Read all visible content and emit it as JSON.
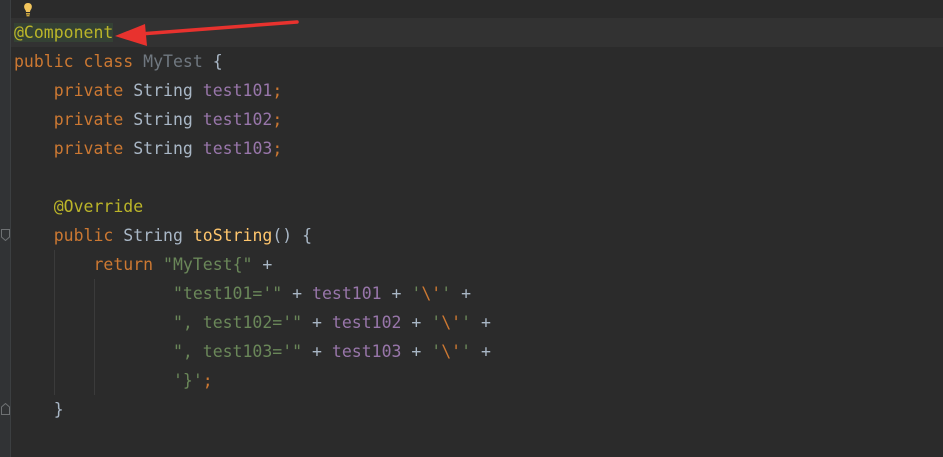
{
  "editor": {
    "language": "Java",
    "colors": {
      "background": "#2b2b2b",
      "keyword": "#cc7832",
      "annotation": "#bbb529",
      "field": "#9876aa",
      "string": "#6a8759",
      "method": "#ffc66d",
      "default": "#a9b7c6",
      "arrow": "#e8322e"
    },
    "lines": [
      [
        {
          "t": "@Component",
          "c": "ann-hl"
        }
      ],
      [
        {
          "t": "public",
          "c": "kw"
        },
        {
          "t": " ",
          "c": "plain"
        },
        {
          "t": "class",
          "c": "kw"
        },
        {
          "t": " ",
          "c": "plain"
        },
        {
          "t": "MyTest",
          "c": "cls-unused"
        },
        {
          "t": " {",
          "c": "plain"
        }
      ],
      [
        {
          "t": "    ",
          "c": "plain"
        },
        {
          "t": "private",
          "c": "kw"
        },
        {
          "t": " String ",
          "c": "plain"
        },
        {
          "t": "test101",
          "c": "field"
        },
        {
          "t": ";",
          "c": "kw"
        }
      ],
      [
        {
          "t": "    ",
          "c": "plain"
        },
        {
          "t": "private",
          "c": "kw"
        },
        {
          "t": " String ",
          "c": "plain"
        },
        {
          "t": "test102",
          "c": "field"
        },
        {
          "t": ";",
          "c": "kw"
        }
      ],
      [
        {
          "t": "    ",
          "c": "plain"
        },
        {
          "t": "private",
          "c": "kw"
        },
        {
          "t": " String ",
          "c": "plain"
        },
        {
          "t": "test103",
          "c": "field"
        },
        {
          "t": ";",
          "c": "kw"
        }
      ],
      [],
      [
        {
          "t": "    ",
          "c": "plain"
        },
        {
          "t": "@Override",
          "c": "ann"
        }
      ],
      [
        {
          "t": "    ",
          "c": "plain"
        },
        {
          "t": "public",
          "c": "kw"
        },
        {
          "t": " String ",
          "c": "plain"
        },
        {
          "t": "toString",
          "c": "method"
        },
        {
          "t": "() {",
          "c": "plain"
        }
      ],
      [
        {
          "t": "        ",
          "c": "plain"
        },
        {
          "t": "return",
          "c": "kw"
        },
        {
          "t": " ",
          "c": "plain"
        },
        {
          "t": "\"MyTest{\"",
          "c": "str"
        },
        {
          "t": " +",
          "c": "plain"
        }
      ],
      [
        {
          "t": "                ",
          "c": "plain"
        },
        {
          "t": "\"test101='\"",
          "c": "str"
        },
        {
          "t": " + ",
          "c": "plain"
        },
        {
          "t": "test101",
          "c": "field"
        },
        {
          "t": " + ",
          "c": "plain"
        },
        {
          "t": "'",
          "c": "str"
        },
        {
          "t": "\\'",
          "c": "esc"
        },
        {
          "t": "'",
          "c": "str"
        },
        {
          "t": " +",
          "c": "plain"
        }
      ],
      [
        {
          "t": "                ",
          "c": "plain"
        },
        {
          "t": "\", test102='\"",
          "c": "str"
        },
        {
          "t": " + ",
          "c": "plain"
        },
        {
          "t": "test102",
          "c": "field"
        },
        {
          "t": " + ",
          "c": "plain"
        },
        {
          "t": "'",
          "c": "str"
        },
        {
          "t": "\\'",
          "c": "esc"
        },
        {
          "t": "'",
          "c": "str"
        },
        {
          "t": " +",
          "c": "plain"
        }
      ],
      [
        {
          "t": "                ",
          "c": "plain"
        },
        {
          "t": "\", test103='\"",
          "c": "str"
        },
        {
          "t": " + ",
          "c": "plain"
        },
        {
          "t": "test103",
          "c": "field"
        },
        {
          "t": " + ",
          "c": "plain"
        },
        {
          "t": "'",
          "c": "str"
        },
        {
          "t": "\\'",
          "c": "esc"
        },
        {
          "t": "'",
          "c": "str"
        },
        {
          "t": " +",
          "c": "plain"
        }
      ],
      [
        {
          "t": "                ",
          "c": "plain"
        },
        {
          "t": "'}'",
          "c": "str"
        },
        {
          "t": ";",
          "c": "kw"
        }
      ],
      [
        {
          "t": "    }",
          "c": "plain"
        }
      ]
    ]
  },
  "icons": {
    "intention_bulb": "lightbulb-icon",
    "fold_markers": "fold-marker-icon",
    "annotation_arrow": "red-arrow-icon"
  }
}
